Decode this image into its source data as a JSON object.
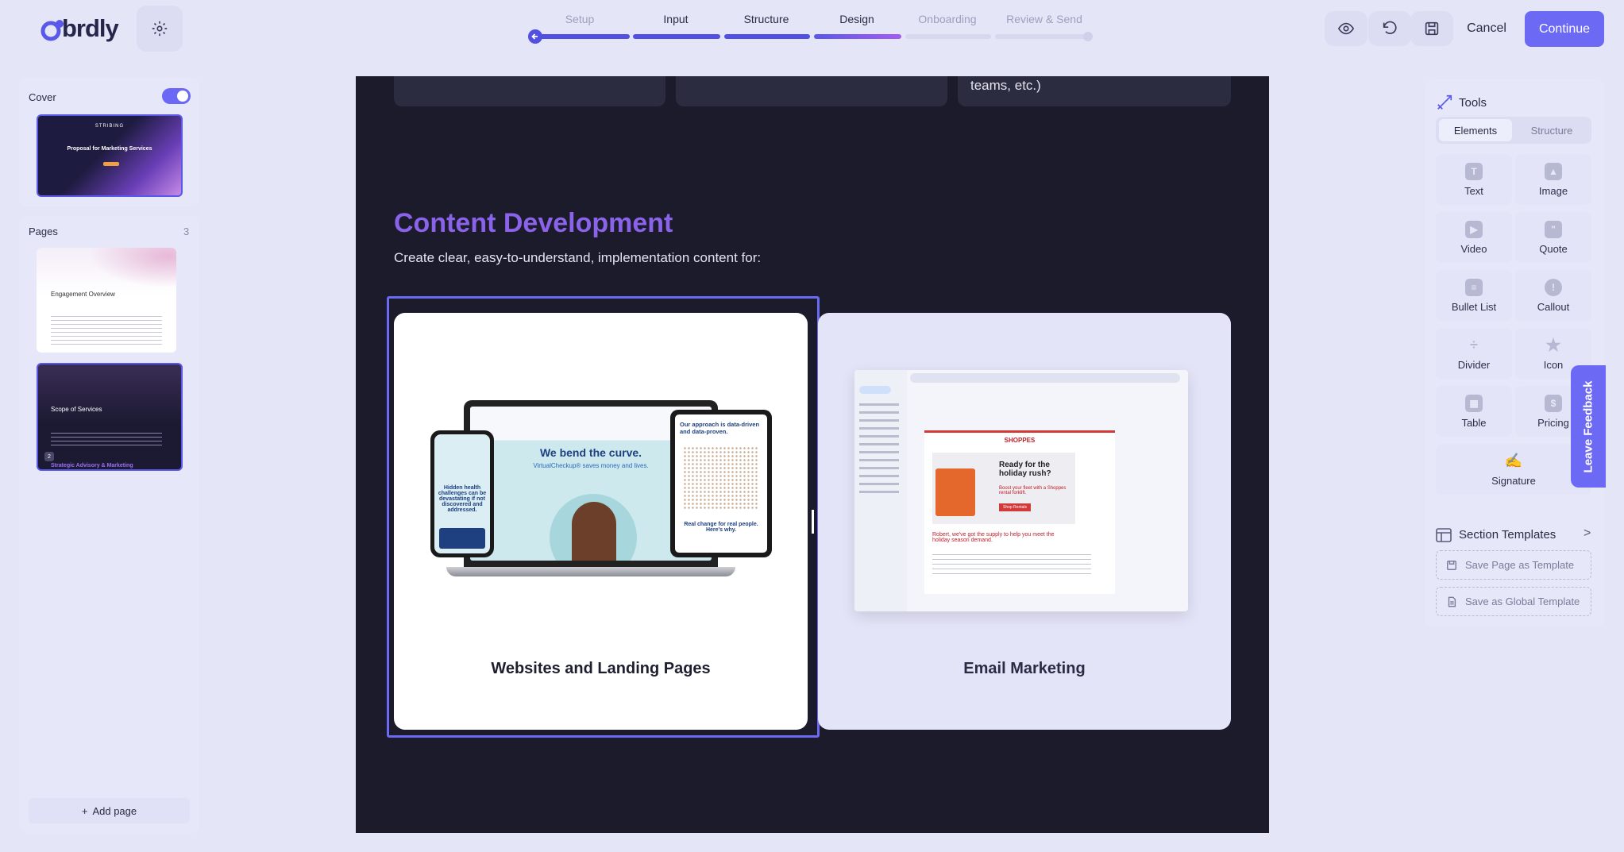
{
  "app": {
    "logo": "brdly"
  },
  "steps": [
    {
      "label": "Setup",
      "state": "complete"
    },
    {
      "label": "Input",
      "state": "complete"
    },
    {
      "label": "Structure",
      "state": "complete"
    },
    {
      "label": "Design",
      "state": "current"
    },
    {
      "label": "Onboarding",
      "state": "upcoming"
    },
    {
      "label": "Review & Send",
      "state": "upcoming"
    }
  ],
  "header": {
    "cancel_label": "Cancel",
    "continue_label": "Continue"
  },
  "sidebar": {
    "cover_label": "Cover",
    "cover_toggle_on": true,
    "cover_thumb": {
      "brand": "STRIBING",
      "title": "Proposal for Marketing Services"
    },
    "pages_label": "Pages",
    "pages_count": "3",
    "pages": [
      {
        "title": "Engagement Overview"
      },
      {
        "title": "Scope of Services",
        "number": "2",
        "footer": "Strategic Advisory & Marketing"
      }
    ],
    "add_page_label": "Add page"
  },
  "canvas": {
    "top_card_text": "teams, etc.)",
    "section_title": "Content Development",
    "section_subtitle": "Create clear, easy-to-understand, implementation content for:",
    "cards": [
      {
        "title": "Websites and Landing Pages",
        "mock": {
          "headline": "We bend the curve.",
          "subline": "VirtualCheckup® saves money and lives.",
          "tablet_head": "Our approach is data-driven and data-proven.",
          "tablet_foot": "Real change for real people. Here's why.",
          "phone_text": "Hidden health challenges can be devastating if not discovered and addressed."
        }
      },
      {
        "title": "Email Marketing",
        "mock": {
          "brand": "SHOPPES",
          "headline": "Ready for the holiday rush?",
          "sub": "Boost your fleet with a Shoppes rental forklift.",
          "cta": "Shop Rentals",
          "body": "Robert, we've got the supply to help you meet the holiday season demand."
        }
      }
    ]
  },
  "tools": {
    "title": "Tools",
    "tabs": [
      "Elements",
      "Structure"
    ],
    "active_tab": "Elements",
    "items": [
      {
        "label": "Text",
        "icon": "text-icon"
      },
      {
        "label": "Image",
        "icon": "image-icon"
      },
      {
        "label": "Video",
        "icon": "video-icon"
      },
      {
        "label": "Quote",
        "icon": "quote-icon"
      },
      {
        "label": "Bullet List",
        "icon": "bullet-list-icon"
      },
      {
        "label": "Callout",
        "icon": "callout-icon"
      },
      {
        "label": "Divider",
        "icon": "divider-icon"
      },
      {
        "label": "Icon",
        "icon": "star-icon"
      },
      {
        "label": "Table",
        "icon": "table-icon"
      },
      {
        "label": "Pricing",
        "icon": "pricing-icon"
      },
      {
        "label": "Signature",
        "icon": "signature-icon"
      }
    ],
    "templates_title": "Section Templates",
    "save_page_label": "Save Page as Template",
    "save_global_label": "Save as Global Template"
  },
  "feedback_label": "Leave Feedback",
  "colors": {
    "accent": "#6c6af5",
    "canvas": "#1b1b2c",
    "heading": "#8b63ea"
  }
}
